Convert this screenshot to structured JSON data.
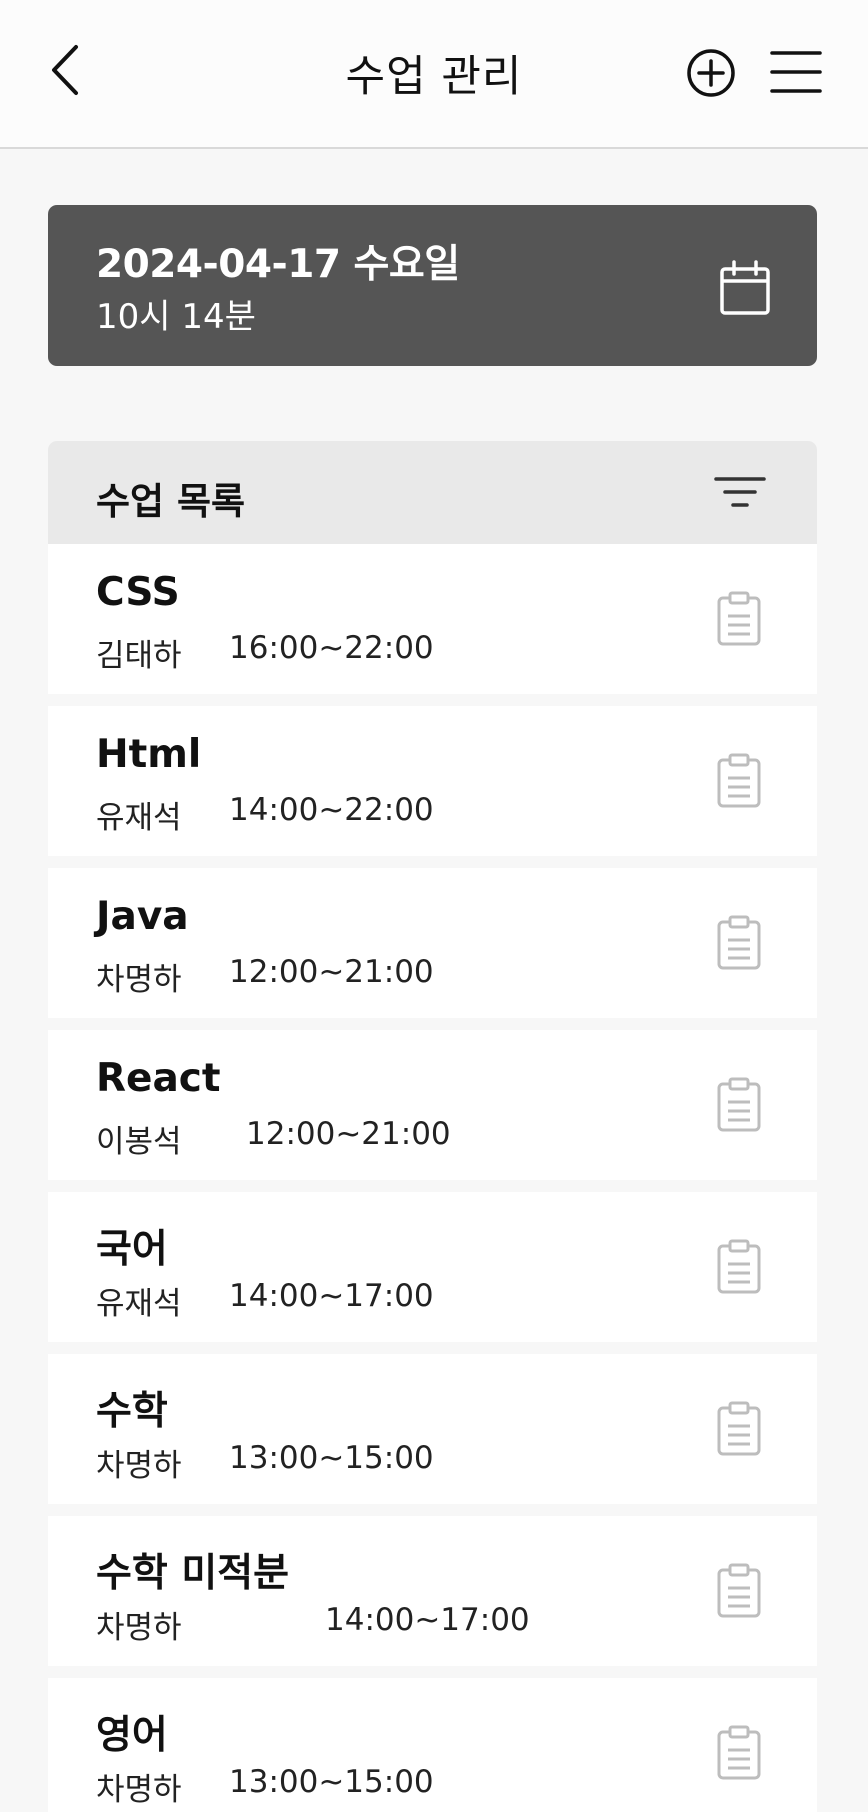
{
  "header": {
    "title": "수업 관리",
    "back_icon": "chevron-left-icon",
    "add_icon": "plus-circle-icon",
    "menu_icon": "hamburger-menu-icon"
  },
  "date_card": {
    "date": "2024-04-17 수요일",
    "time": "10시 14분",
    "icon": "calendar-icon",
    "background_color": "#555555"
  },
  "class_list": {
    "title": "수업 목록",
    "filter_icon": "filter-icon",
    "items": [
      {
        "name": "CSS",
        "teacher": "김태하",
        "time": "16:00~22:00"
      },
      {
        "name": "Html",
        "teacher": "유재석",
        "time": "14:00~22:00"
      },
      {
        "name": "Java",
        "teacher": "차명하",
        "time": "12:00~21:00"
      },
      {
        "name": "React",
        "teacher": "이봉석",
        "time": "12:00~21:00"
      },
      {
        "name": "국어",
        "teacher": "유재석",
        "time": "14:00~17:00"
      },
      {
        "name": "수학",
        "teacher": "차명하",
        "time": "13:00~15:00"
      },
      {
        "name": "수학 미적분",
        "teacher": "차명하",
        "time": "14:00~17:00"
      },
      {
        "name": "영어",
        "teacher": "차명하",
        "time": "13:00~15:00"
      }
    ],
    "item_icon": "clipboard-icon"
  }
}
